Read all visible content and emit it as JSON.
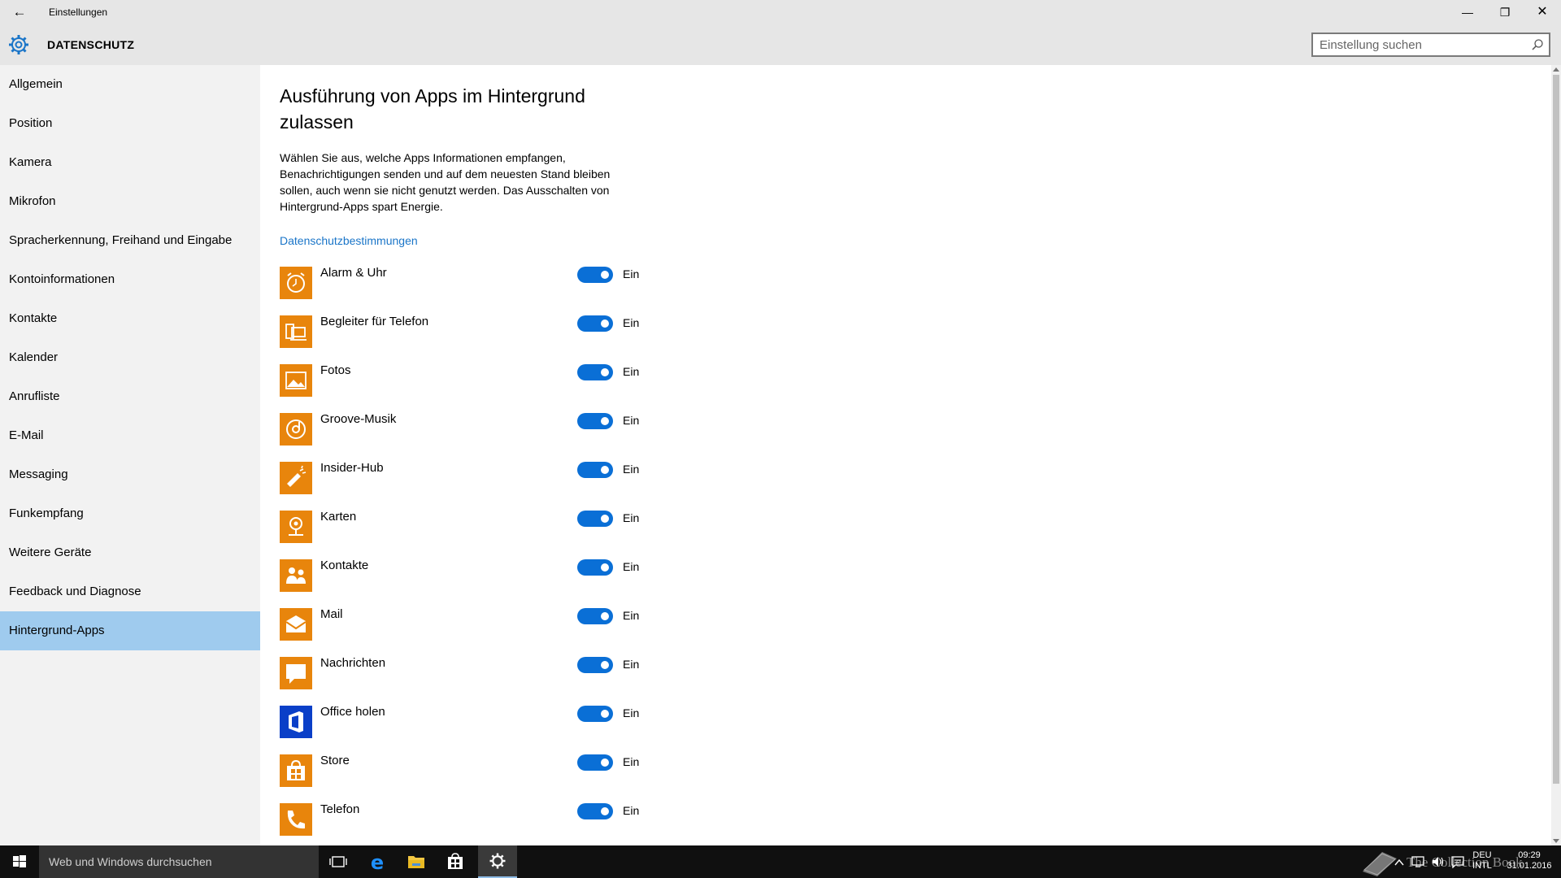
{
  "window": {
    "title": "Einstellungen",
    "back_glyph": "←",
    "minimize_glyph": "—",
    "maximize_glyph": "❐",
    "close_glyph": "✕"
  },
  "header": {
    "title": "DATENSCHUTZ",
    "icon": "gear-icon",
    "accent": "#1a75c8"
  },
  "search": {
    "placeholder": "Einstellung suchen",
    "value": ""
  },
  "sidebar": {
    "items": [
      {
        "label": "Allgemein"
      },
      {
        "label": "Position"
      },
      {
        "label": "Kamera"
      },
      {
        "label": "Mikrofon"
      },
      {
        "label": "Spracherkennung, Freihand und Eingabe"
      },
      {
        "label": "Kontoinformationen"
      },
      {
        "label": "Kontakte"
      },
      {
        "label": "Kalender"
      },
      {
        "label": "Anrufliste"
      },
      {
        "label": "E-Mail"
      },
      {
        "label": "Messaging"
      },
      {
        "label": "Funkempfang"
      },
      {
        "label": "Weitere Geräte"
      },
      {
        "label": "Feedback und Diagnose"
      },
      {
        "label": "Hintergrund-Apps"
      }
    ],
    "active_color": "#9fcbee"
  },
  "main": {
    "title": "Ausführung von Apps im Hintergrund zulassen",
    "description": "Wählen Sie aus, welche Apps Informationen empfangen, Benachrichtigungen senden und auf dem neuesten Stand bleiben sollen, auch wenn sie nicht genutzt werden. Das Ausschalten von Hintergrund-Apps spart Energie.",
    "privacy_link": "Datenschutzbestimmungen",
    "toggle_color": "#0a6fd6",
    "apps": [
      {
        "name": "Alarm & Uhr",
        "state": "Ein",
        "icon": "alarm-clock-icon",
        "color": "#e8850c"
      },
      {
        "name": "Begleiter für Telefon",
        "state": "Ein",
        "icon": "phone-companion-icon",
        "color": "#e8850c"
      },
      {
        "name": "Fotos",
        "state": "Ein",
        "icon": "photos-icon",
        "color": "#e8850c"
      },
      {
        "name": "Groove-Musik",
        "state": "Ein",
        "icon": "groove-music-icon",
        "color": "#e8850c"
      },
      {
        "name": "Insider-Hub",
        "state": "Ein",
        "icon": "megaphone-icon",
        "color": "#e8850c"
      },
      {
        "name": "Karten",
        "state": "Ein",
        "icon": "maps-icon",
        "color": "#e8850c"
      },
      {
        "name": "Kontakte",
        "state": "Ein",
        "icon": "people-icon",
        "color": "#e8850c"
      },
      {
        "name": "Mail",
        "state": "Ein",
        "icon": "mail-icon",
        "color": "#e8850c"
      },
      {
        "name": "Nachrichten",
        "state": "Ein",
        "icon": "messaging-icon",
        "color": "#e8850c"
      },
      {
        "name": "Office holen",
        "state": "Ein",
        "icon": "office-icon",
        "color": "#0a3fc8"
      },
      {
        "name": "Store",
        "state": "Ein",
        "icon": "store-icon",
        "color": "#e8850c"
      },
      {
        "name": "Telefon",
        "state": "Ein",
        "icon": "phone-icon",
        "color": "#e8850c"
      }
    ]
  },
  "taskbar": {
    "search_placeholder": "Web und Windows durchsuchen",
    "language": "DEU",
    "layout": "INTL",
    "time": "09:29",
    "date": "31.01.2016",
    "watermark": "The Collection Book"
  }
}
